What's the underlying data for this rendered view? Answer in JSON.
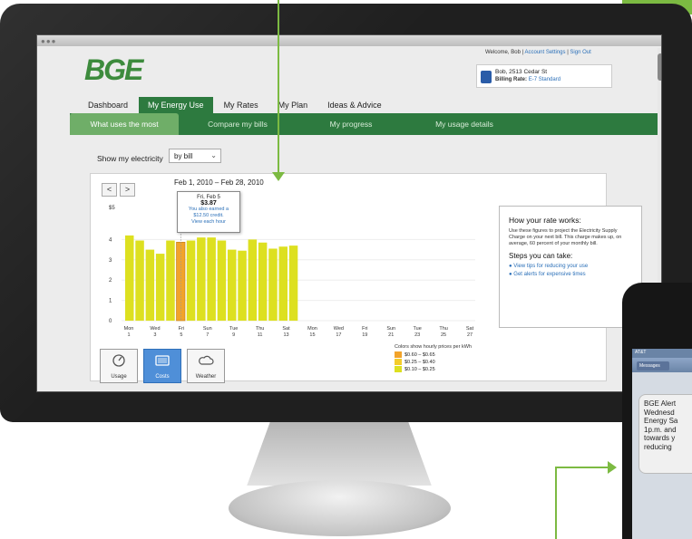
{
  "browser": {
    "controls": "●●●"
  },
  "header": {
    "logo": "BGE",
    "welcome": "Welcome, Bob",
    "account_settings": "Account Settings",
    "sign_out": "Sign Out",
    "address": "Bob, 2513 Cedar St",
    "rate_label": "Billing Rate:",
    "rate_value": "E-7 Standard"
  },
  "nav": {
    "tabs": [
      "Dashboard",
      "My Energy Use",
      "My Rates",
      "My Plan",
      "Ideas & Advice"
    ]
  },
  "subnav": {
    "tabs": [
      "What uses the most",
      "Compare my bills",
      "My progress",
      "My usage details"
    ]
  },
  "filter": {
    "label": "Show my electricity",
    "value": "by bill"
  },
  "chart": {
    "range": "Feb 1, 2010 – Feb 28, 2010",
    "prev": "<",
    "next": ">",
    "unit": "$5",
    "tooltip": {
      "date": "Fri, Feb 5",
      "amount": "$3.87",
      "line1": "You also earned a",
      "line2": "$12.50 credit.",
      "link": "View each hour"
    }
  },
  "chart_data": {
    "type": "bar",
    "yticks": [
      "4",
      "3",
      "2",
      "1",
      "0"
    ],
    "ylim": [
      0,
      5
    ],
    "x_days": [
      "Mon",
      "Wed",
      "Fri",
      "Sun",
      "Tue",
      "Thu",
      "Sat",
      "Mon",
      "Wed",
      "Fri",
      "Sun",
      "Tue",
      "Thu",
      "Sat"
    ],
    "x_nums": [
      "1",
      "3",
      "5",
      "7",
      "9",
      "11",
      "13",
      "15",
      "17",
      "19",
      "21",
      "23",
      "25",
      "27"
    ],
    "values": [
      4.2,
      3.95,
      3.5,
      3.3,
      3.95,
      3.87,
      3.95,
      4.1,
      4.1,
      3.95,
      3.5,
      3.45,
      4.0,
      3.85,
      3.55,
      3.65,
      3.7
    ],
    "highlight_index": 5,
    "colors": {
      "bar": "#dde020",
      "highlight": "#f2a32a"
    }
  },
  "rate_info": {
    "title": "How your rate works:",
    "body": "Use these figures to project the Electricity Supply Charge on your next bill. This charge makes up, on average, 60 percent of your monthly bill.",
    "steps_title": "Steps you can take:",
    "links": [
      "View tips for reducing your use",
      "Get alerts for expensive times"
    ]
  },
  "tools": [
    {
      "label": "Usage",
      "icon": "gauge-icon"
    },
    {
      "label": "Costs",
      "icon": "card-icon"
    },
    {
      "label": "Weather",
      "icon": "cloud-icon"
    }
  ],
  "legend": {
    "title": "Colors show hourly prices per kWh",
    "items": [
      {
        "range": "$0.60 – $0.65",
        "color": "#f2a32a"
      },
      {
        "range": "$0.25 – $0.40",
        "color": "#f4cc2a"
      },
      {
        "range": "$0.10 – $0.25",
        "color": "#dde020"
      }
    ]
  },
  "phone": {
    "carrier": "AT&T",
    "back": "Messages",
    "message": "BGE Alert\nWednesd\nEnergy Sa\n1p.m. and\ntowards y\nreducing"
  }
}
